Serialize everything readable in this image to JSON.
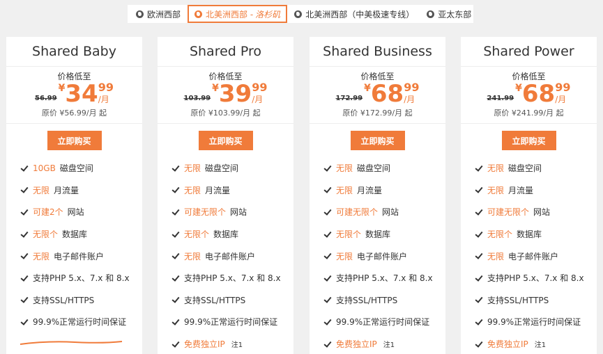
{
  "regions": [
    {
      "label": "欧洲西部",
      "sub": ""
    },
    {
      "label": "北美洲西部 - ",
      "sub": "洛杉矶"
    },
    {
      "label": "北美洲西部（中美极速专线）",
      "sub": ""
    },
    {
      "label": "亚太东部",
      "sub": ""
    }
  ],
  "active_region": 1,
  "accent_color": "#f07b3a",
  "plans": [
    {
      "name": "Shared Baby",
      "lowest_label": "价格低至",
      "old_price": "56.99",
      "currency": "¥",
      "price_int": "34",
      "price_dec": "99",
      "per": "/月",
      "orig_price": "原价 ¥56.99/月 起",
      "buy_label": "立即购买",
      "features": [
        {
          "hl": "10GB",
          "text": "磁盘空间"
        },
        {
          "hl": "无限",
          "text": "月流量"
        },
        {
          "hl": "可建2个",
          "text": "网站"
        },
        {
          "hl": "无限个",
          "text": "数据库"
        },
        {
          "hl": "无限",
          "text": "电子邮件账户"
        },
        {
          "hl": "",
          "text": "支持PHP 5.x、7.x 和 8.x"
        },
        {
          "hl": "",
          "text": "支持SSL/HTTPS"
        },
        {
          "hl": "",
          "text": "99.9%正常运行时间保证"
        }
      ]
    },
    {
      "name": "Shared Pro",
      "lowest_label": "价格低至",
      "old_price": "103.99",
      "currency": "¥",
      "price_int": "39",
      "price_dec": "99",
      "per": "/月",
      "orig_price": "原价 ¥103.99/月 起",
      "buy_label": "立即购买",
      "features": [
        {
          "hl": "无限",
          "text": "磁盘空间"
        },
        {
          "hl": "无限",
          "text": "月流量"
        },
        {
          "hl": "可建无限个",
          "text": "网站"
        },
        {
          "hl": "无限个",
          "text": "数据库"
        },
        {
          "hl": "无限",
          "text": "电子邮件账户"
        },
        {
          "hl": "",
          "text": "支持PHP 5.x、7.x 和 8.x"
        },
        {
          "hl": "",
          "text": "支持SSL/HTTPS"
        },
        {
          "hl": "",
          "text": "99.9%正常运行时间保证"
        },
        {
          "hl": "免费独立IP",
          "text": "",
          "sup": "注1"
        }
      ]
    },
    {
      "name": "Shared Business",
      "lowest_label": "价格低至",
      "old_price": "172.99",
      "currency": "¥",
      "price_int": "68",
      "price_dec": "99",
      "per": "/月",
      "orig_price": "原价 ¥172.99/月 起",
      "buy_label": "立即购买",
      "features": [
        {
          "hl": "无限",
          "text": "磁盘空间"
        },
        {
          "hl": "无限",
          "text": "月流量"
        },
        {
          "hl": "可建无限个",
          "text": "网站"
        },
        {
          "hl": "无限个",
          "text": "数据库"
        },
        {
          "hl": "无限",
          "text": "电子邮件账户"
        },
        {
          "hl": "",
          "text": "支持PHP 5.x、7.x 和 8.x"
        },
        {
          "hl": "",
          "text": "支持SSL/HTTPS"
        },
        {
          "hl": "",
          "text": "99.9%正常运行时间保证"
        },
        {
          "hl": "免费独立IP",
          "text": "",
          "sup": "注1"
        }
      ]
    },
    {
      "name": "Shared Power",
      "lowest_label": "价格低至",
      "old_price": "241.99",
      "currency": "¥",
      "price_int": "68",
      "price_dec": "99",
      "per": "/月",
      "orig_price": "原价 ¥241.99/月 起",
      "buy_label": "立即购买",
      "features": [
        {
          "hl": "无限",
          "text": "磁盘空间"
        },
        {
          "hl": "无限",
          "text": "月流量"
        },
        {
          "hl": "可建无限个",
          "text": "网站"
        },
        {
          "hl": "无限个",
          "text": "数据库"
        },
        {
          "hl": "无限",
          "text": "电子邮件账户"
        },
        {
          "hl": "",
          "text": "支持PHP 5.x、7.x 和 8.x"
        },
        {
          "hl": "",
          "text": "支持SSL/HTTPS"
        },
        {
          "hl": "",
          "text": "99.9%正常运行时间保证"
        },
        {
          "hl": "免费独立IP",
          "text": "",
          "sup": "注1"
        }
      ]
    }
  ]
}
